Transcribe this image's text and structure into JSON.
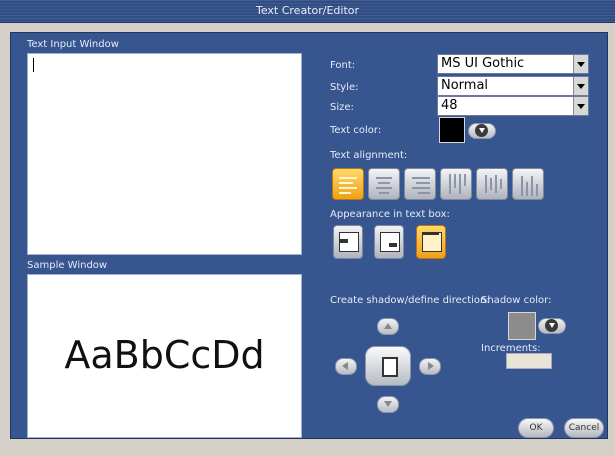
{
  "window": {
    "title": "Text Creator/Editor"
  },
  "text_input": {
    "label": "Text Input Window",
    "value": ""
  },
  "sample": {
    "label": "Sample Window",
    "text": "AaBbCcDd"
  },
  "font": {
    "label": "Font:",
    "value": "MS UI Gothic"
  },
  "style": {
    "label": "Style:",
    "value": "Normal"
  },
  "size": {
    "label": "Size:",
    "value": "48"
  },
  "text_color": {
    "label": "Text color:",
    "color": "#000000"
  },
  "alignment": {
    "label": "Text alignment:",
    "buttons": [
      "align-left",
      "align-center",
      "align-right",
      "vertical-top",
      "vertical-center",
      "vertical-bottom"
    ],
    "selected": 0
  },
  "appearance": {
    "label": "Appearance in text box:",
    "buttons": [
      "appearance-top",
      "appearance-middle",
      "appearance-fill"
    ],
    "selected": 2
  },
  "shadow": {
    "direction_label": "Create shadow/define direction:",
    "color_label": "Shadow color:",
    "increments_label": "Increments:",
    "color": "#8c8c8c",
    "increments_value": ""
  },
  "buttons": {
    "ok": "OK",
    "cancel": "Cancel"
  },
  "colors": {
    "panel": "#37558f",
    "selected": "#f5a623"
  }
}
